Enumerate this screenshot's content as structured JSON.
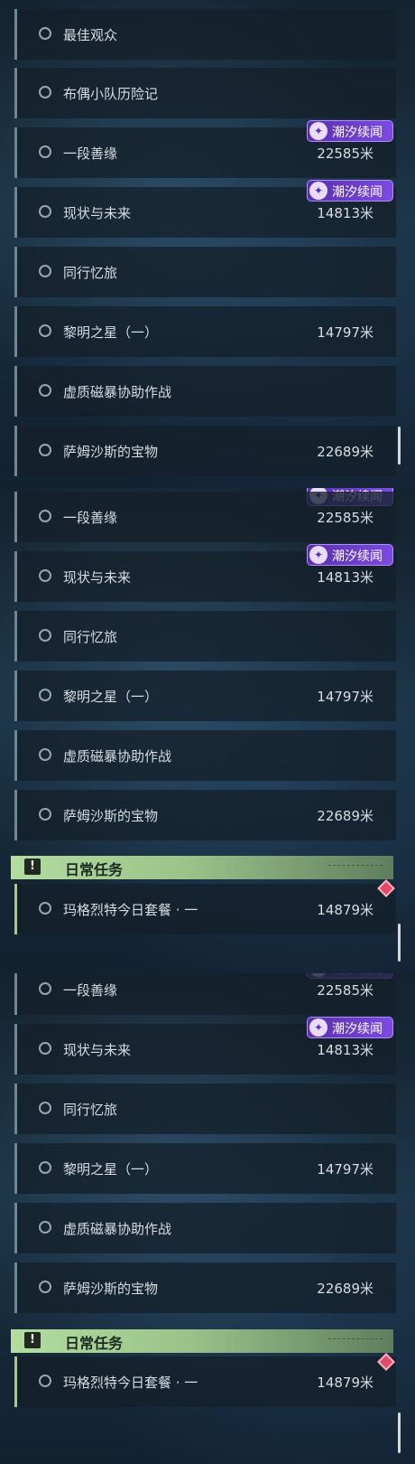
{
  "badge_text": "潮汐续闻",
  "daily_header": "日常任务",
  "panel1": {
    "quests": [
      {
        "label": "最佳观众",
        "distance": ""
      },
      {
        "label": "布偶小队历险记",
        "distance": ""
      },
      {
        "label": "一段善缘",
        "distance": "22585米"
      },
      {
        "label": "现状与未来",
        "distance": "14813米"
      },
      {
        "label": "同行忆旅",
        "distance": ""
      },
      {
        "label": "黎明之星（一）",
        "distance": "14797米"
      },
      {
        "label": "虚质磁暴协助作战",
        "distance": ""
      },
      {
        "label": "萨姆沙斯的宝物",
        "distance": "22689米"
      }
    ]
  },
  "panel2": {
    "quests": [
      {
        "label": "一段善缘",
        "distance": "22585米"
      },
      {
        "label": "现状与未来",
        "distance": "14813米"
      },
      {
        "label": "同行忆旅",
        "distance": ""
      },
      {
        "label": "黎明之星（一）",
        "distance": "14797米"
      },
      {
        "label": "虚质磁暴协助作战",
        "distance": ""
      },
      {
        "label": "萨姆沙斯的宝物",
        "distance": "22689米"
      }
    ],
    "daily": [
      {
        "label": "玛格烈特今日套餐 · 一",
        "distance": "14879米"
      }
    ]
  },
  "panel3": {
    "quests": [
      {
        "label": "一段善缘",
        "distance": "22585米"
      },
      {
        "label": "现状与未来",
        "distance": "14813米"
      },
      {
        "label": "同行忆旅",
        "distance": ""
      },
      {
        "label": "黎明之星（一）",
        "distance": "14797米"
      },
      {
        "label": "虚质磁暴协助作战",
        "distance": ""
      },
      {
        "label": "萨姆沙斯的宝物",
        "distance": "22689米"
      }
    ],
    "daily": [
      {
        "label": "玛格烈特今日套餐 · 一",
        "distance": "14879米"
      }
    ]
  }
}
